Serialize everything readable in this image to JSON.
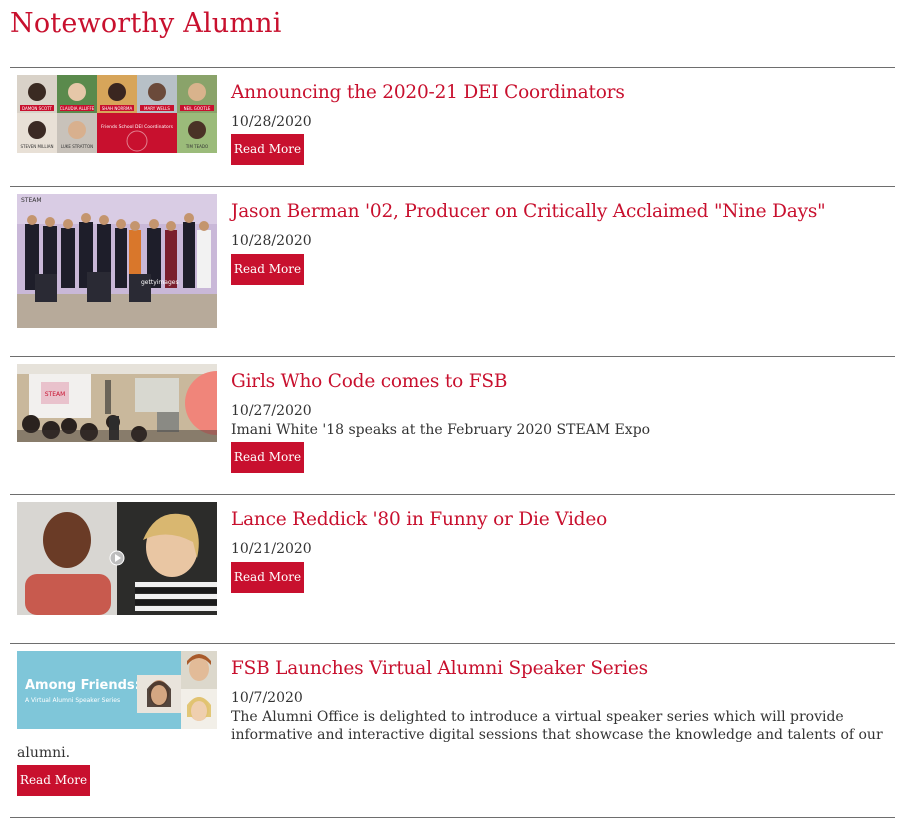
{
  "page": {
    "title": "Noteworthy Alumni"
  },
  "items": [
    {
      "title": "Announcing the 2020-21 DEI Coordinators",
      "date": "10/28/2020",
      "button": "Read More",
      "thumb_labels": [
        "DAMON SCOTT",
        "CLAUDIA ALLIFFE",
        "SHAH NORRMA",
        "MARY WELLS",
        "NEIL GOOTLE",
        "STEVEN MILLIAN",
        "LUKE STRATTON",
        "Friends School DEI Coordinators",
        "TIM TEADO"
      ]
    },
    {
      "title": "Jason Berman '02, Producer on Critically Acclaimed \"Nine Days\"",
      "date": "10/28/2020",
      "button": "Read More",
      "thumb_labels": [
        "STEAM",
        "gettyimages"
      ]
    },
    {
      "title": "Girls Who Code comes to FSB",
      "date": "10/27/2020",
      "summary": "Imani White '18 speaks at the February 2020 STEAM Expo",
      "button": "Read More",
      "thumb_labels": [
        "STEAM"
      ]
    },
    {
      "title": "Lance Reddick '80 in Funny or Die Video",
      "date": "10/21/2020",
      "button": "Read More"
    },
    {
      "title": "FSB Launches Virtual Alumni Speaker Series",
      "date": "10/7/2020",
      "summary_line1": "The Alumni Office is delighted to introduce a virtual speaker series which will provide",
      "summary_line2": "informative and interactive digital sessions that showcase the knowledge and talents of our",
      "summary_line3": "alumni.",
      "button": "Read More",
      "thumb_labels": [
        "Among Friends:",
        "A Virtual Alumni Speaker Series"
      ]
    }
  ],
  "colors": {
    "accent": "#c8102e",
    "text": "#333333",
    "rule": "#6e6e6e"
  }
}
